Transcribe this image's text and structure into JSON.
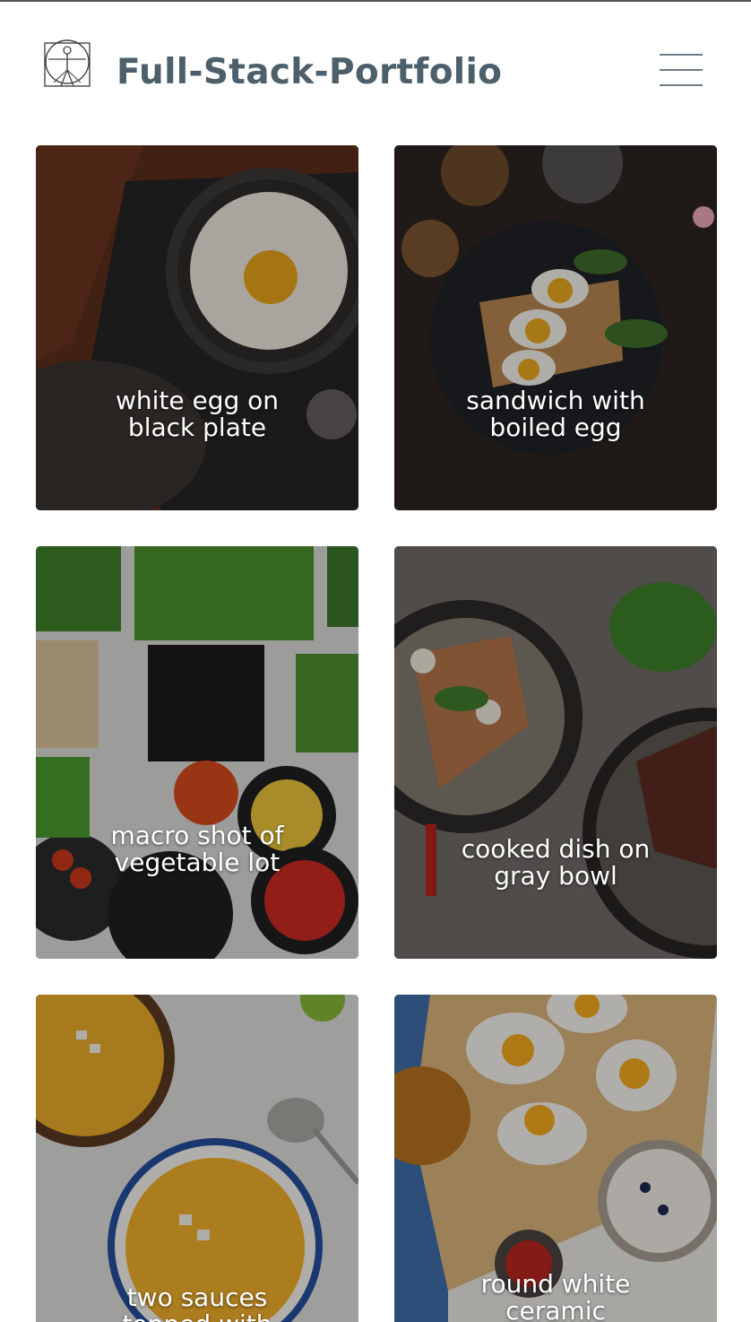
{
  "header": {
    "brand": "Full-Stack-Portfolio",
    "logo_icon": "vitruvian-man-icon",
    "menu_icon": "hamburger-menu-icon"
  },
  "colors": {
    "brand_text": "#4d5f6b",
    "menu_bars": "#6d7c85",
    "caption_text": "#ffffff"
  },
  "gallery": [
    {
      "caption": "white egg on black plate"
    },
    {
      "caption": "sandwich with boiled egg"
    },
    {
      "caption": "macro shot of vegetable lot"
    },
    {
      "caption": "cooked dish on gray bowl"
    },
    {
      "caption": "two sauces topped with"
    },
    {
      "caption": "round white ceramic"
    }
  ]
}
